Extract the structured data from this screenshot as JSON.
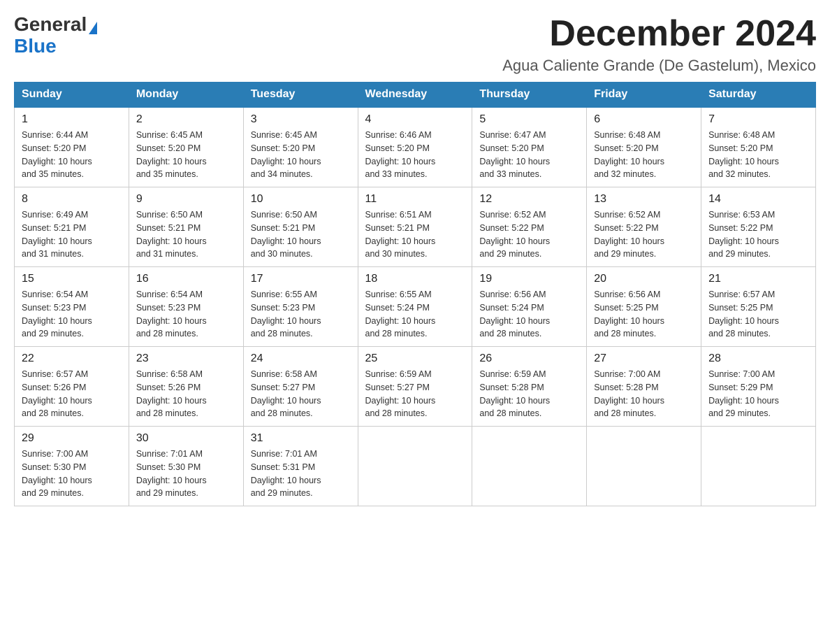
{
  "logo": {
    "general": "General",
    "blue": "Blue"
  },
  "header": {
    "month_year": "December 2024",
    "location": "Agua Caliente Grande (De Gastelum), Mexico"
  },
  "weekdays": [
    "Sunday",
    "Monday",
    "Tuesday",
    "Wednesday",
    "Thursday",
    "Friday",
    "Saturday"
  ],
  "weeks": [
    [
      {
        "day": "1",
        "sunrise": "6:44 AM",
        "sunset": "5:20 PM",
        "daylight": "10 hours and 35 minutes."
      },
      {
        "day": "2",
        "sunrise": "6:45 AM",
        "sunset": "5:20 PM",
        "daylight": "10 hours and 35 minutes."
      },
      {
        "day": "3",
        "sunrise": "6:45 AM",
        "sunset": "5:20 PM",
        "daylight": "10 hours and 34 minutes."
      },
      {
        "day": "4",
        "sunrise": "6:46 AM",
        "sunset": "5:20 PM",
        "daylight": "10 hours and 33 minutes."
      },
      {
        "day": "5",
        "sunrise": "6:47 AM",
        "sunset": "5:20 PM",
        "daylight": "10 hours and 33 minutes."
      },
      {
        "day": "6",
        "sunrise": "6:48 AM",
        "sunset": "5:20 PM",
        "daylight": "10 hours and 32 minutes."
      },
      {
        "day": "7",
        "sunrise": "6:48 AM",
        "sunset": "5:20 PM",
        "daylight": "10 hours and 32 minutes."
      }
    ],
    [
      {
        "day": "8",
        "sunrise": "6:49 AM",
        "sunset": "5:21 PM",
        "daylight": "10 hours and 31 minutes."
      },
      {
        "day": "9",
        "sunrise": "6:50 AM",
        "sunset": "5:21 PM",
        "daylight": "10 hours and 31 minutes."
      },
      {
        "day": "10",
        "sunrise": "6:50 AM",
        "sunset": "5:21 PM",
        "daylight": "10 hours and 30 minutes."
      },
      {
        "day": "11",
        "sunrise": "6:51 AM",
        "sunset": "5:21 PM",
        "daylight": "10 hours and 30 minutes."
      },
      {
        "day": "12",
        "sunrise": "6:52 AM",
        "sunset": "5:22 PM",
        "daylight": "10 hours and 29 minutes."
      },
      {
        "day": "13",
        "sunrise": "6:52 AM",
        "sunset": "5:22 PM",
        "daylight": "10 hours and 29 minutes."
      },
      {
        "day": "14",
        "sunrise": "6:53 AM",
        "sunset": "5:22 PM",
        "daylight": "10 hours and 29 minutes."
      }
    ],
    [
      {
        "day": "15",
        "sunrise": "6:54 AM",
        "sunset": "5:23 PM",
        "daylight": "10 hours and 29 minutes."
      },
      {
        "day": "16",
        "sunrise": "6:54 AM",
        "sunset": "5:23 PM",
        "daylight": "10 hours and 28 minutes."
      },
      {
        "day": "17",
        "sunrise": "6:55 AM",
        "sunset": "5:23 PM",
        "daylight": "10 hours and 28 minutes."
      },
      {
        "day": "18",
        "sunrise": "6:55 AM",
        "sunset": "5:24 PM",
        "daylight": "10 hours and 28 minutes."
      },
      {
        "day": "19",
        "sunrise": "6:56 AM",
        "sunset": "5:24 PM",
        "daylight": "10 hours and 28 minutes."
      },
      {
        "day": "20",
        "sunrise": "6:56 AM",
        "sunset": "5:25 PM",
        "daylight": "10 hours and 28 minutes."
      },
      {
        "day": "21",
        "sunrise": "6:57 AM",
        "sunset": "5:25 PM",
        "daylight": "10 hours and 28 minutes."
      }
    ],
    [
      {
        "day": "22",
        "sunrise": "6:57 AM",
        "sunset": "5:26 PM",
        "daylight": "10 hours and 28 minutes."
      },
      {
        "day": "23",
        "sunrise": "6:58 AM",
        "sunset": "5:26 PM",
        "daylight": "10 hours and 28 minutes."
      },
      {
        "day": "24",
        "sunrise": "6:58 AM",
        "sunset": "5:27 PM",
        "daylight": "10 hours and 28 minutes."
      },
      {
        "day": "25",
        "sunrise": "6:59 AM",
        "sunset": "5:27 PM",
        "daylight": "10 hours and 28 minutes."
      },
      {
        "day": "26",
        "sunrise": "6:59 AM",
        "sunset": "5:28 PM",
        "daylight": "10 hours and 28 minutes."
      },
      {
        "day": "27",
        "sunrise": "7:00 AM",
        "sunset": "5:28 PM",
        "daylight": "10 hours and 28 minutes."
      },
      {
        "day": "28",
        "sunrise": "7:00 AM",
        "sunset": "5:29 PM",
        "daylight": "10 hours and 29 minutes."
      }
    ],
    [
      {
        "day": "29",
        "sunrise": "7:00 AM",
        "sunset": "5:30 PM",
        "daylight": "10 hours and 29 minutes."
      },
      {
        "day": "30",
        "sunrise": "7:01 AM",
        "sunset": "5:30 PM",
        "daylight": "10 hours and 29 minutes."
      },
      {
        "day": "31",
        "sunrise": "7:01 AM",
        "sunset": "5:31 PM",
        "daylight": "10 hours and 29 minutes."
      },
      null,
      null,
      null,
      null
    ]
  ],
  "labels": {
    "sunrise": "Sunrise:",
    "sunset": "Sunset:",
    "daylight": "Daylight:"
  }
}
